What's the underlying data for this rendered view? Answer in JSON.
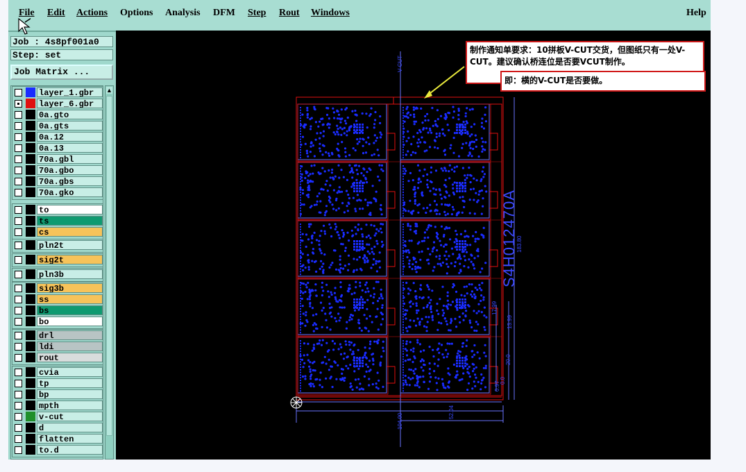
{
  "menu": {
    "file": "File",
    "edit": "Edit",
    "actions": "Actions",
    "options": "Options",
    "analysis": "Analysis",
    "dfm": "DFM",
    "step": "Step",
    "rout": "Rout",
    "windows": "Windows",
    "help": "Help"
  },
  "job": {
    "label": "Job : 4s8pf001a0",
    "step": "Step: set",
    "matrix_button": "Job Matrix ..."
  },
  "layers": [
    {
      "name": "layer_1.gbr",
      "swatch": "#1a2cff",
      "bg": "#c8eee6",
      "checked": false
    },
    {
      "name": "layer_6.gbr",
      "swatch": "#e01010",
      "bg": "#c8eee6",
      "checked": true
    },
    {
      "name": "0a.gto",
      "swatch": "#000000",
      "bg": "#c8eee6",
      "checked": false
    },
    {
      "name": "0a.gts",
      "swatch": "#000000",
      "bg": "#c8eee6",
      "checked": false
    },
    {
      "name": "0a.12",
      "swatch": "#000000",
      "bg": "#c8eee6",
      "checked": false
    },
    {
      "name": "0a.13",
      "swatch": "#000000",
      "bg": "#c8eee6",
      "checked": false
    },
    {
      "name": "70a.gbl",
      "swatch": "#000000",
      "bg": "#c8eee6",
      "checked": false
    },
    {
      "name": "70a.gbo",
      "swatch": "#000000",
      "bg": "#c8eee6",
      "checked": false
    },
    {
      "name": "70a.gbs",
      "swatch": "#000000",
      "bg": "#c8eee6",
      "checked": false
    },
    {
      "name": "70a.gko",
      "swatch": "#000000",
      "bg": "#c8eee6",
      "checked": false
    },
    {
      "name": "to",
      "swatch": "#000000",
      "bg": "#ffffff",
      "checked": false
    },
    {
      "name": "ts",
      "swatch": "#000000",
      "bg": "#0f9a70",
      "checked": false
    },
    {
      "name": "cs",
      "swatch": "#000000",
      "bg": "#f6c35a",
      "checked": false
    },
    {
      "name": "pln2t",
      "swatch": "#000000",
      "bg": "#c8eee6",
      "checked": false
    },
    {
      "name": "sig2t",
      "swatch": "#000000",
      "bg": "#f6c35a",
      "checked": false
    },
    {
      "name": "pln3b",
      "swatch": "#000000",
      "bg": "#c8eee6",
      "checked": false
    },
    {
      "name": "sig3b",
      "swatch": "#000000",
      "bg": "#f6c35a",
      "checked": false
    },
    {
      "name": "ss",
      "swatch": "#000000",
      "bg": "#f6c35a",
      "checked": false
    },
    {
      "name": "bs",
      "swatch": "#000000",
      "bg": "#0f9a70",
      "checked": false
    },
    {
      "name": "bo",
      "swatch": "#000000",
      "bg": "#ffffff",
      "checked": false
    },
    {
      "name": "drl",
      "swatch": "#000000",
      "bg": "#b8c4c4",
      "checked": false
    },
    {
      "name": "ldi",
      "swatch": "#000000",
      "bg": "#b8c4c4",
      "checked": false
    },
    {
      "name": "rout",
      "swatch": "#000000",
      "bg": "#d8dcdc",
      "checked": false
    },
    {
      "name": "cvia",
      "swatch": "#000000",
      "bg": "#c8eee6",
      "checked": false
    },
    {
      "name": "tp",
      "swatch": "#000000",
      "bg": "#c8eee6",
      "checked": false
    },
    {
      "name": "bp",
      "swatch": "#000000",
      "bg": "#c8eee6",
      "checked": false
    },
    {
      "name": "mpth",
      "swatch": "#000000",
      "bg": "#c8eee6",
      "checked": false
    },
    {
      "name": "v-cut",
      "swatch": "#1f8f2a",
      "bg": "#c8eee6",
      "checked": false
    },
    {
      "name": "d",
      "swatch": "#000000",
      "bg": "#c8eee6",
      "checked": false
    },
    {
      "name": "flatten",
      "swatch": "#000000",
      "bg": "#c8eee6",
      "checked": false
    },
    {
      "name": "to.d",
      "swatch": "#000000",
      "bg": "#c8eee6",
      "checked": false
    }
  ],
  "canvas": {
    "note1": "制作通知单要求：10拼板V-CUT交货，但图纸只有一处V-CUT。建议确认桥连位是否要VCUT制作。",
    "note2": "即：横的V-CUT是否要做。",
    "part_number": "S4H012470A",
    "vcut_label": "V-CUT",
    "dims": {
      "total_height": "183.80",
      "width_total": "104.00",
      "half_width": "52.04",
      "d1": "17.99",
      "d2": "13.99",
      "d3": "20.0",
      "d4": "0.0",
      "d5": "0.97"
    }
  },
  "colors": {
    "board": "#1a2cff",
    "outline": "#e01010",
    "background": "#000000",
    "panel": "#9fd8cc"
  }
}
